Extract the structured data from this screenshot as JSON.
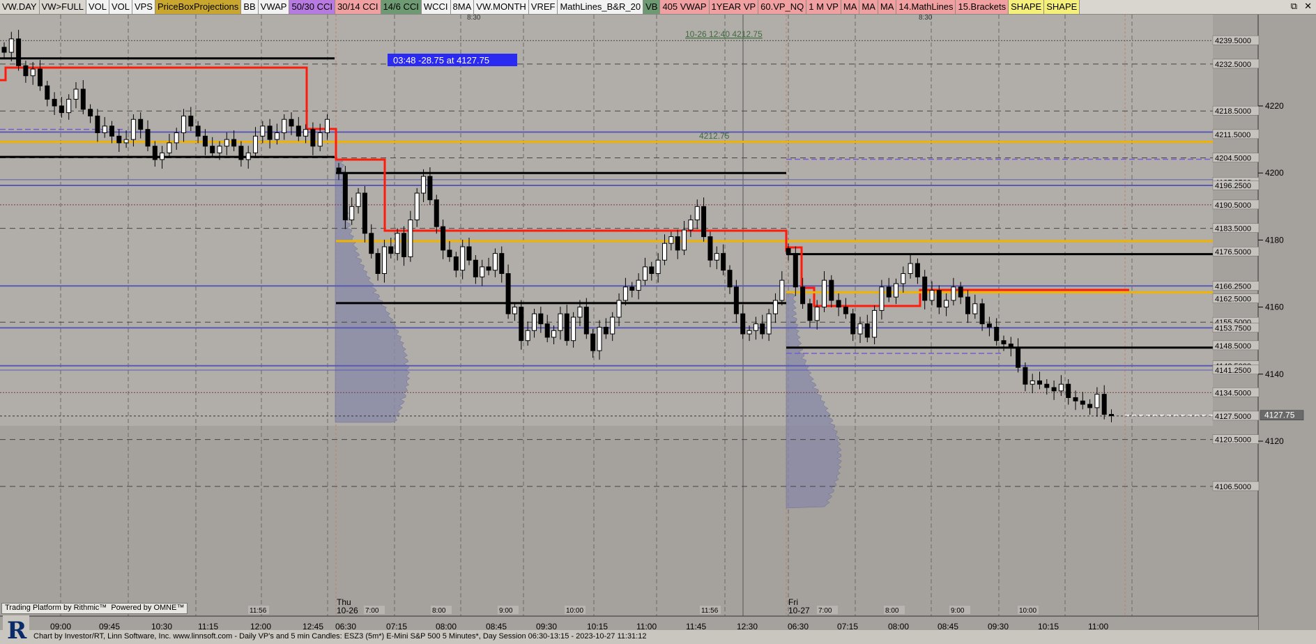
{
  "toolbar": {
    "items": [
      {
        "label": "VW.DAY",
        "bg": "#d9d6d0"
      },
      {
        "label": "VW>FULL",
        "bg": "#d9d6d0"
      },
      {
        "label": "VOL",
        "bg": "#f2f2f2"
      },
      {
        "label": "VOL",
        "bg": "#f2f2f2"
      },
      {
        "label": "VPS",
        "bg": "#f2f2f2"
      },
      {
        "label": "PriceBoxProjections",
        "bg": "#c9a72e"
      },
      {
        "label": "BB",
        "bg": "#f2f2f2"
      },
      {
        "label": "VWAP",
        "bg": "#f2f2f2"
      },
      {
        "label": "50/30 CCI",
        "bg": "#b77ae0"
      },
      {
        "label": "30/14 CCI",
        "bg": "#f0a0a0"
      },
      {
        "label": "14/6 CCI",
        "bg": "#6e9a73"
      },
      {
        "label": "WCCI",
        "bg": "#f2f2f2"
      },
      {
        "label": "8MA",
        "bg": "#f2f2f2"
      },
      {
        "label": "VW.MONTH",
        "bg": "#f2f2f2"
      },
      {
        "label": "VREF",
        "bg": "#f2f2f2"
      },
      {
        "label": "MathLines_B&R_20",
        "bg": "#f2f2f2"
      },
      {
        "label": "VB",
        "bg": "#6e9a73"
      },
      {
        "label": "405 VWAP",
        "bg": "#f0a0a0"
      },
      {
        "label": "1YEAR VP",
        "bg": "#f0a0a0"
      },
      {
        "label": "60.VP_NQ",
        "bg": "#f0a0a0"
      },
      {
        "label": "1 M VP",
        "bg": "#f0a0a0"
      },
      {
        "label": "MA",
        "bg": "#f0a0a0"
      },
      {
        "label": "MA",
        "bg": "#f0a0a0"
      },
      {
        "label": "MA",
        "bg": "#f0a0a0"
      },
      {
        "label": "14.MathLines",
        "bg": "#f0a0a0"
      },
      {
        "label": "15.Brackets",
        "bg": "#f0a0a0"
      },
      {
        "label": "SHAPE",
        "bg": "#f5f07a"
      },
      {
        "label": "SHAPE",
        "bg": "#f5f07a"
      }
    ],
    "window_controls": [
      "⧉",
      "✕"
    ]
  },
  "annotations": {
    "tooltip": "03:48  -28.75 at 4127.75",
    "measure": "10-26 12:40  4212.75",
    "level_note": "4212.75",
    "time_830_a": "8:30",
    "time_830_b": "8:30"
  },
  "footer": {
    "text": "Chart by Investor/RT, Linn Software, Inc. www.linnsoft.com - Daily VP's and 5 min Candles: ESZ3 (5m*) E-Mini S&P 500 5 Minutes*, Day Session 06:30-13:15 - 2023-10-27 11:31:12",
    "platform_a": "Trading Platform by Rithmic™",
    "platform_b": "Powered by OMNE™",
    "logo": "R"
  },
  "chart_data": {
    "type": "candlestick",
    "instrument": "ESZ3 (5m*) E-Mini S&P 500 5 Minutes*",
    "ylim": [
      4100,
      4243
    ],
    "right_axis_ticks": [
      4220,
      4200,
      4180,
      4160,
      4140,
      4120
    ],
    "price_labels": [
      "4239.5000",
      "4232.5000",
      "4218.5000",
      "4211.5000",
      "4204.5000",
      "4197.2500",
      "4196.2500",
      "4190.5000",
      "4183.5000",
      "4176.5000",
      "4166.2500",
      "4162.5000",
      "4155.5000",
      "4153.7500",
      "4148.5000",
      "4142.5000",
      "4141.2500",
      "4134.5000",
      "4127.5000",
      "4120.5000",
      "4106.5000"
    ],
    "last_price_label": "4127.75",
    "x_labels": [
      "09:00",
      "09:45",
      "10:30",
      "11:15",
      "12:00",
      "12:45",
      "06:30",
      "07:15",
      "08:00",
      "08:45",
      "09:30",
      "10:15",
      "11:00",
      "11:45",
      "12:30",
      "06:30",
      "07:15",
      "08:00",
      "08:45",
      "09:30",
      "10:15",
      "11:00"
    ],
    "session_labels": [
      {
        "day": "Thu",
        "date": "10-26"
      },
      {
        "day": "Fri",
        "date": "10-27"
      }
    ],
    "minor_time_labels": [
      "11:56",
      "7:00",
      "8:00",
      "9:00",
      "10:00",
      "11:56",
      "7:00",
      "8:00",
      "9:00",
      "10:00"
    ],
    "colors": {
      "red_line": "#ff1a0a",
      "gold_line": "#f0b400",
      "blue_line": "#5a5ab4",
      "black_line": "#000000",
      "bull": "#ffffff",
      "bear": "#000000",
      "vp": "#8a8aa8"
    },
    "candles": {
      "day1": [
        4236,
        4240,
        4232,
        4229,
        4231,
        4226,
        4222,
        4220,
        4218,
        4222,
        4225,
        4219,
        4217,
        4212,
        4214,
        4211,
        4209,
        4210,
        4216,
        4213,
        4208,
        4204,
        4206,
        4209,
        4212,
        4217,
        4214,
        4211,
        4208,
        4206,
        4208,
        4210,
        4208,
        4204,
        4206,
        4211,
        4214,
        4210,
        4212,
        4216,
        4214,
        4211,
        4213,
        4208,
        4212,
        4216
      ],
      "day2": [
        4200,
        4186,
        4190,
        4194,
        4182,
        4176,
        4170,
        4178,
        4176,
        4182,
        4175,
        4186,
        4194,
        4199,
        4192,
        4184,
        4177,
        4175,
        4171,
        4178,
        4174,
        4169,
        4172,
        4171,
        4176,
        4170,
        4158,
        4160,
        4150,
        4153,
        4158,
        4155,
        4151,
        4153,
        4158,
        4150,
        4157,
        4160,
        4152,
        4147,
        4154,
        4152,
        4157,
        4162,
        4166,
        4165,
        4168,
        4172,
        4170,
        4174,
        4179,
        4181,
        4177,
        4183,
        4186,
        4190,
        4181,
        4174,
        4176,
        4171,
        4166,
        4158,
        4152,
        4153,
        4155,
        4152,
        4158,
        4162,
        4168
      ],
      "day3": [
        4176,
        4166,
        4161,
        4156,
        4160,
        4168,
        4162,
        4160,
        4158,
        4152,
        4155,
        4151,
        4159,
        4166,
        4163,
        4167,
        4170,
        4173,
        4169,
        4162,
        4165,
        4160,
        4162,
        4166,
        4163,
        4158,
        4161,
        4155,
        4154,
        4150,
        4149,
        4148,
        4142,
        4137,
        4138,
        4137,
        4136,
        4135,
        4137,
        4133,
        4132,
        4131,
        4130,
        4134,
        4128,
        4127.75
      ]
    }
  }
}
